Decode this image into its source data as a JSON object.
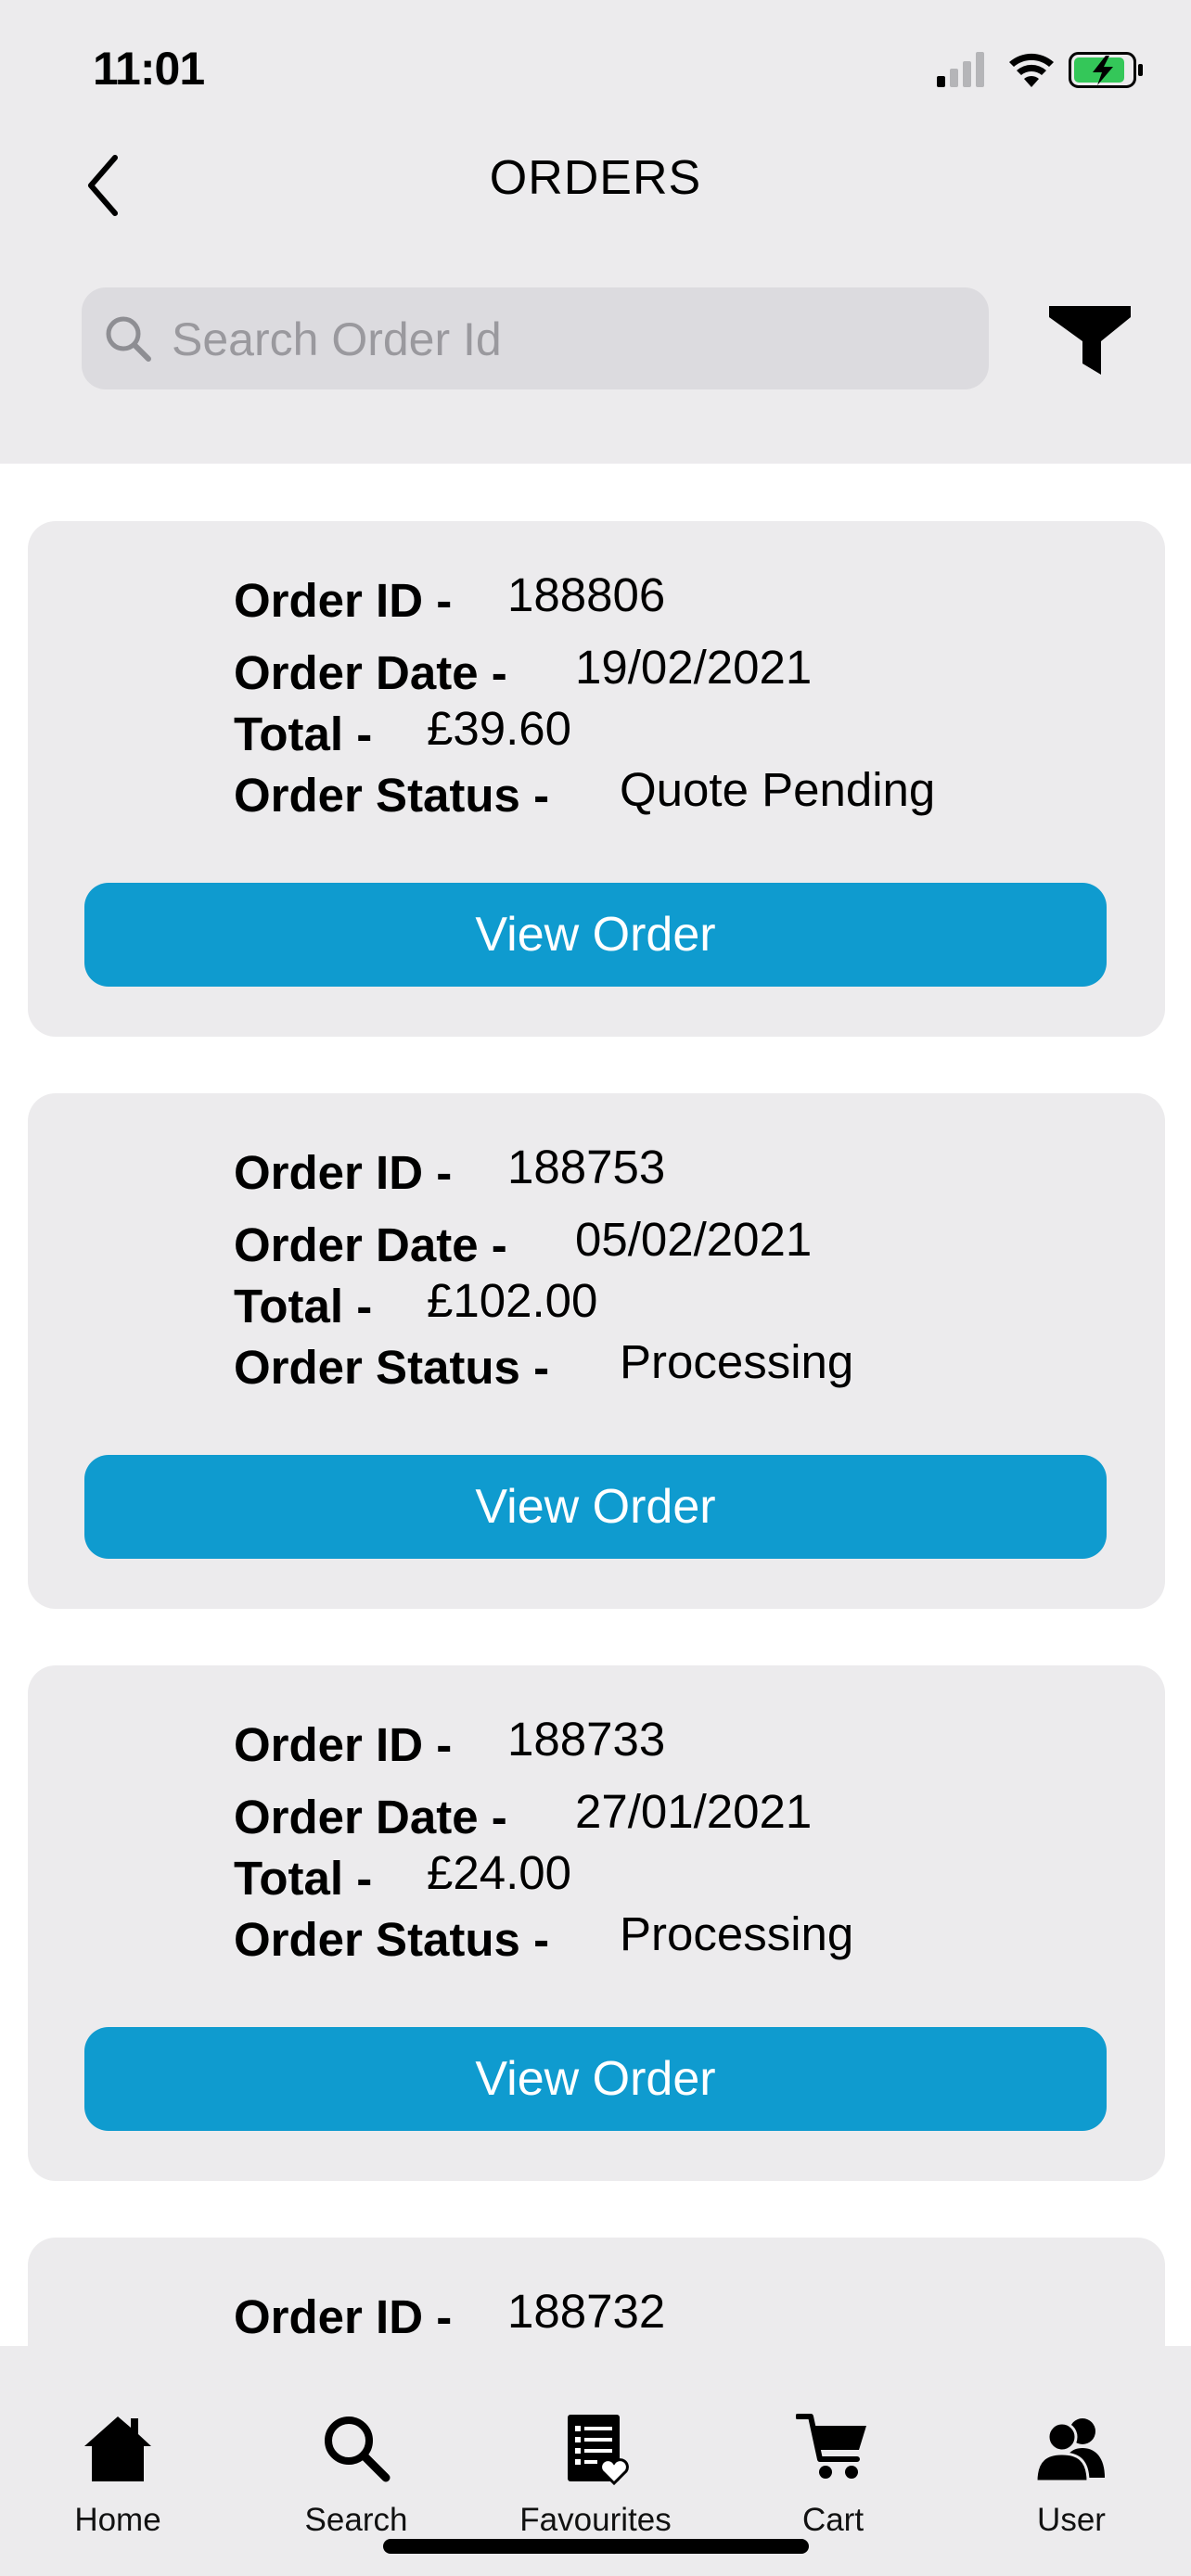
{
  "status_bar": {
    "time": "11:01"
  },
  "header": {
    "title": "ORDERS"
  },
  "search": {
    "placeholder": "Search Order Id"
  },
  "labels": {
    "order_id": "Order ID -",
    "order_date": "Order Date -",
    "total": "Total -",
    "order_status": "Order Status -"
  },
  "orders": [
    {
      "id": "188806",
      "date": "19/02/2021",
      "total": "£39.60",
      "status": "Quote Pending",
      "button": "View Order"
    },
    {
      "id": "188753",
      "date": "05/02/2021",
      "total": "£102.00",
      "status": "Processing",
      "button": "View Order"
    },
    {
      "id": "188733",
      "date": "27/01/2021",
      "total": "£24.00",
      "status": "Processing",
      "button": "View Order"
    },
    {
      "id": "188732"
    }
  ],
  "tab_bar": {
    "items": [
      {
        "label": "Home",
        "icon": "home-icon"
      },
      {
        "label": "Search",
        "icon": "search-icon"
      },
      {
        "label": "Favourites",
        "icon": "favourites-icon"
      },
      {
        "label": "Cart",
        "icon": "cart-icon"
      },
      {
        "label": "User",
        "icon": "user-icon"
      }
    ]
  },
  "colors": {
    "accent": "#0f9bcf",
    "header_background": "#ecebed",
    "card_background": "#ecebed",
    "battery_green": "#34c759"
  }
}
